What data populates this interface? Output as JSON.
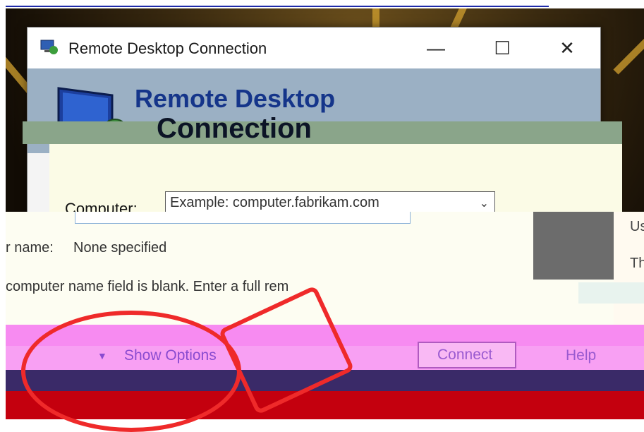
{
  "window": {
    "title": "Remote Desktop Connection",
    "controls": {
      "minimize": "—",
      "maximize": "☐",
      "close": "✕"
    }
  },
  "banner": {
    "line1": "Remote Desktop",
    "line2": "Connection"
  },
  "form": {
    "computer_label": "Computer:",
    "computer_placeholder": "Example: computer.fabrikam.com",
    "user_label": "User name:",
    "user_label_visible": "r name:",
    "user_value": "None specified",
    "hint": "computer name field is blank. Enter a full rem"
  },
  "side_labels": {
    "u": "Us",
    "th": "Th"
  },
  "footer": {
    "show_options": "Show Options",
    "connect": "Connect",
    "help": "Help"
  },
  "colors": {
    "banner_title": "#15358a",
    "accent_pink": "#f8a0f3",
    "glitch_red": "#c4000e"
  },
  "icons": [
    "app-icon",
    "monitor-logo-icon",
    "chevron-down-icon",
    "minimize-icon",
    "maximize-icon",
    "close-icon"
  ]
}
